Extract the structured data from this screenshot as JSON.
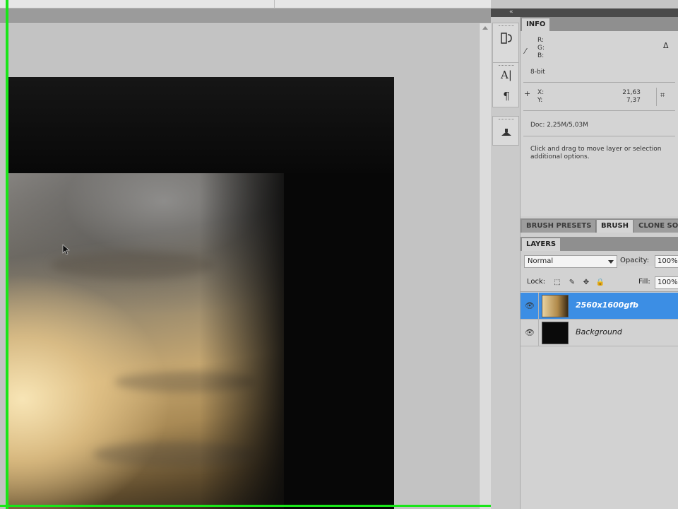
{
  "panel_tabs": {
    "info": "INFO",
    "brush_presets": "BRUSH PRESETS",
    "brush": "BRUSH",
    "clone_source": "CLONE SO",
    "layers": "LAYERS"
  },
  "info": {
    "r_label": "R:",
    "g_label": "G:",
    "b_label": "B:",
    "bit_depth": "8-bit",
    "x_label": "X:",
    "y_label": "Y:",
    "x_value": "21,63",
    "y_value": "7,37",
    "doc_size": "Doc: 2,25M/5,03M",
    "hint_line1": "Click and drag to move layer or selection",
    "hint_line2": "additional options."
  },
  "layers_panel": {
    "blend_mode": "Normal",
    "opacity_label": "Opacity:",
    "opacity_value": "100%",
    "lock_label": "Lock:",
    "fill_label": "Fill:",
    "fill_value": "100%",
    "layers": [
      {
        "name": "2560x1600gfb",
        "selected": true
      },
      {
        "name": "Background",
        "selected": false
      }
    ]
  },
  "tool_icons": [
    "history-icon",
    "character-icon",
    "paragraph-icon",
    "clone-source-icon"
  ],
  "colors": {
    "selection": "#3c8ee4",
    "guide_green": "#19e619"
  }
}
